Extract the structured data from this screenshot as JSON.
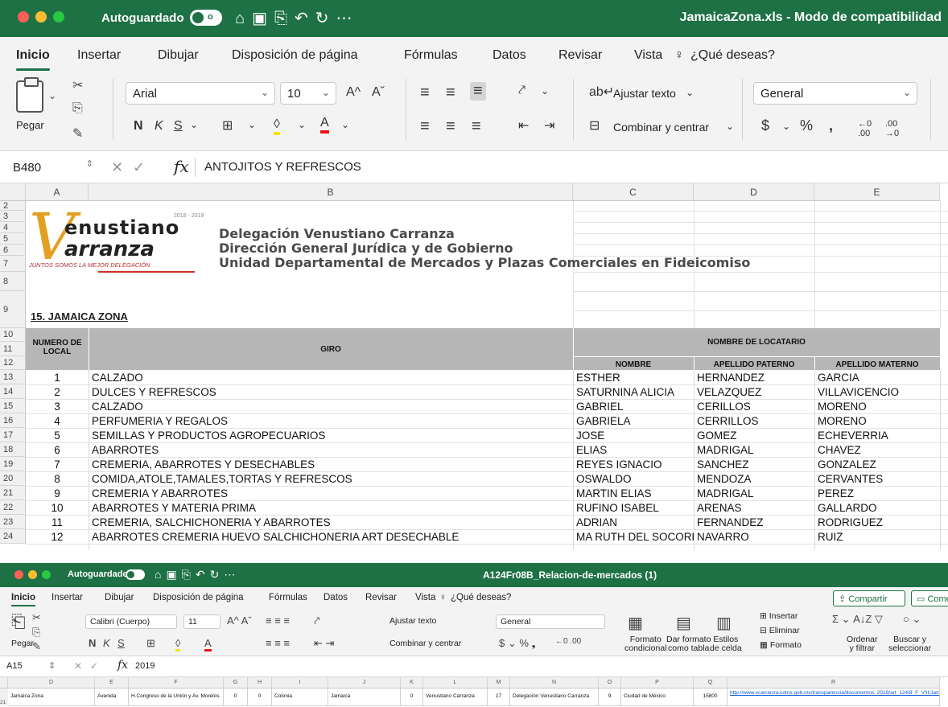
{
  "win1": {
    "autosave_label": "Autoguardado",
    "toggle_state": "o",
    "title": "JamaicaZona.xls  -  Modo de compatibilidad",
    "tabs": [
      "Inicio",
      "Insertar",
      "Dibujar",
      "Disposición de página",
      "Fórmulas",
      "Datos",
      "Revisar",
      "Vista",
      "¿Qué deseas?"
    ],
    "ribbon": {
      "paste_label": "Pegar",
      "font_name": "Arial",
      "font_size": "10",
      "bold": "N",
      "italic": "K",
      "underline": "S",
      "wrap_text": "Ajustar texto",
      "merge_center": "Combinar y centrar",
      "number_format": "General"
    },
    "formula_bar": {
      "name_box": "B480",
      "fx": "fx",
      "content": "ANTOJITOS Y REFRESCOS"
    },
    "columns": [
      "A",
      "B",
      "C",
      "D",
      "E"
    ],
    "logo": {
      "line1": "enustiano",
      "line2": "arranza",
      "years": "2018 - 2019",
      "slogan": "JUNTOS SOMOS LA MEJOR DELEGACIÓN"
    },
    "header_lines": [
      "Delegación Venustiano Carranza",
      "Dirección General Jurídica y de Gobierno",
      "Unidad Departamental de Mercados y Plazas Comerciales en Fideicomiso"
    ],
    "sheet_title": "15. JAMAICA ZONA",
    "table_headers": {
      "numero": "NUMERO DE LOCAL",
      "giro": "GIRO",
      "locatario": "NOMBRE DE LOCATARIO",
      "nombre": "NOMBRE",
      "ap_paterno": "APELLIDO PATERNO",
      "ap_materno": "APELLIDO MATERNO"
    },
    "rows": [
      {
        "r": "13",
        "n": "1",
        "giro": "CALZADO",
        "nombre": "ESTHER",
        "pat": "HERNANDEZ",
        "mat": "GARCIA"
      },
      {
        "r": "14",
        "n": "2",
        "giro": "DULCES Y REFRESCOS",
        "nombre": "SATURNINA ALICIA",
        "pat": "VELAZQUEZ",
        "mat": "VILLAVICENCIO"
      },
      {
        "r": "15",
        "n": "3",
        "giro": "CALZADO",
        "nombre": "GABRIEL",
        "pat": "CERILLOS",
        "mat": "MORENO"
      },
      {
        "r": "16",
        "n": "4",
        "giro": "PERFUMERIA Y REGALOS",
        "nombre": "GABRIELA",
        "pat": "CERRILLOS",
        "mat": "MORENO"
      },
      {
        "r": "17",
        "n": "5",
        "giro": "SEMILLAS Y PRODUCTOS AGROPECUARIOS",
        "nombre": "JOSE",
        "pat": "GOMEZ",
        "mat": "ECHEVERRIA"
      },
      {
        "r": "18",
        "n": "6",
        "giro": "ABARROTES",
        "nombre": "ELIAS",
        "pat": "MADRIGAL",
        "mat": "CHAVEZ"
      },
      {
        "r": "19",
        "n": "7",
        "giro": "CREMERIA, ABARROTES Y DESECHABLES",
        "nombre": "REYES IGNACIO",
        "pat": "SANCHEZ",
        "mat": "GONZALEZ"
      },
      {
        "r": "20",
        "n": "8",
        "giro": "COMIDA,ATOLE,TAMALES,TORTAS Y REFRESCOS",
        "nombre": "OSWALDO",
        "pat": "MENDOZA",
        "mat": "CERVANTES"
      },
      {
        "r": "21",
        "n": "9",
        "giro": "CREMERIA Y ABARROTES",
        "nombre": "MARTIN ELIAS",
        "pat": "MADRIGAL",
        "mat": "PEREZ"
      },
      {
        "r": "22",
        "n": "10",
        "giro": "ABARROTES Y MATERIA PRIMA",
        "nombre": "RUFINO ISABEL",
        "pat": "ARENAS",
        "mat": "GALLARDO"
      },
      {
        "r": "23",
        "n": "11",
        "giro": "CREMERIA, SALCHICHONERIA Y ABARROTES",
        "nombre": "ADRIAN",
        "pat": "FERNANDEZ",
        "mat": "RODRIGUEZ"
      },
      {
        "r": "24",
        "n": "12",
        "giro": "ABARROTES CREMERIA HUEVO SALCHICHONERIA ART DESECHABLE",
        "nombre": "MA RUTH DEL SOCORRO",
        "pat": "NAVARRO",
        "mat": "RUIZ"
      }
    ]
  },
  "win2": {
    "autosave_label": "Autoguardado",
    "title": "A124Fr08B_Relacion-de-mercados (1)",
    "tabs": [
      "Inicio",
      "Insertar",
      "Dibujar",
      "Disposición de página",
      "Fórmulas",
      "Datos",
      "Revisar",
      "Vista",
      "¿Qué deseas?"
    ],
    "share": "Compartir",
    "comments": "Come",
    "ribbon": {
      "paste_label": "Pegar",
      "font_name": "Calibri (Cuerpo)",
      "font_size": "11",
      "wrap_text": "Ajustar texto",
      "merge_center": "Combinar y centrar",
      "number_format": "General",
      "cond_format_1": "Formato",
      "cond_format_2": "condicional",
      "table_format_1": "Dar formato",
      "table_format_2": "como tabla",
      "cell_styles_1": "Estilos",
      "cell_styles_2": "de celda",
      "insert": "Insertar",
      "delete": "Eliminar",
      "format": "Formato",
      "sort_1": "Ordenar",
      "sort_2": "y filtrar",
      "find_1": "Buscar y",
      "find_2": "seleccionar"
    },
    "formula_bar": {
      "name_box": "A15",
      "fx": "fx",
      "content": "2019"
    },
    "columns": [
      "D",
      "E",
      "F",
      "G",
      "H",
      "I",
      "J",
      "K",
      "L",
      "M",
      "N",
      "O",
      "P",
      "Q",
      "R"
    ],
    "row_number": "21",
    "cells": [
      "Jamaica Zona",
      "Avenida",
      "H.Congreso de la Unión y Av. Morelos",
      "0",
      "0",
      "Colonia",
      "Jamaica",
      "0",
      "Venustiano Carranza",
      "17",
      "Delegación Venustiano Carranza",
      "9",
      "Ciudad de México",
      "15800",
      "http://www.vcarranza.cdmx.gob.mx/transparencia/documentos_2019/art_124/8_F_VIII/JamaicaZona.xls"
    ]
  }
}
